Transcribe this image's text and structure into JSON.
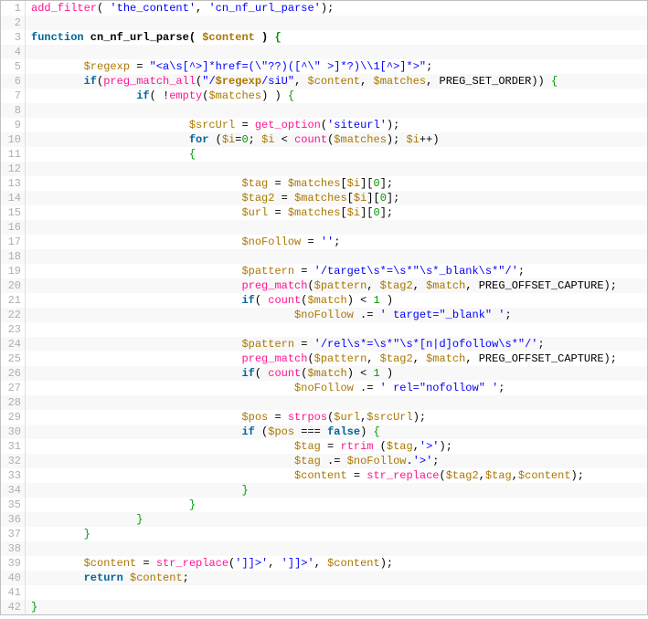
{
  "lines": [
    {
      "n": 1,
      "segs": [
        {
          "t": "add_filter",
          "c": "fn"
        },
        {
          "t": "( ",
          "c": ""
        },
        {
          "t": "'the_content'",
          "c": "str"
        },
        {
          "t": ", ",
          "c": ""
        },
        {
          "t": "'cn_nf_url_parse'",
          "c": "str"
        },
        {
          "t": ");",
          "c": ""
        }
      ]
    },
    {
      "n": 2,
      "segs": []
    },
    {
      "n": 3,
      "segs": [
        {
          "t": "function",
          "c": "kw bold"
        },
        {
          "t": " cn_nf_url_parse( ",
          "c": "bold"
        },
        {
          "t": "$content",
          "c": "var bold"
        },
        {
          "t": " ) ",
          "c": "bold"
        },
        {
          "t": "{",
          "c": "brace bold"
        }
      ]
    },
    {
      "n": 4,
      "segs": []
    },
    {
      "n": 5,
      "segs": [
        {
          "t": "        ",
          "c": ""
        },
        {
          "t": "$regexp",
          "c": "var"
        },
        {
          "t": " = ",
          "c": ""
        },
        {
          "t": "\"<a\\s[^>]*href=(\\\"??)([^\\\" >]*?)\\\\1[^>]*>\"",
          "c": "str"
        },
        {
          "t": ";",
          "c": ""
        }
      ]
    },
    {
      "n": 6,
      "segs": [
        {
          "t": "        ",
          "c": ""
        },
        {
          "t": "if",
          "c": "kw"
        },
        {
          "t": "(",
          "c": ""
        },
        {
          "t": "preg_match_all",
          "c": "fn"
        },
        {
          "t": "(",
          "c": ""
        },
        {
          "t": "\"/",
          "c": "str"
        },
        {
          "t": "$regexp",
          "c": "var bold"
        },
        {
          "t": "/siU\"",
          "c": "str"
        },
        {
          "t": ", ",
          "c": ""
        },
        {
          "t": "$content",
          "c": "var"
        },
        {
          "t": ", ",
          "c": ""
        },
        {
          "t": "$matches",
          "c": "var"
        },
        {
          "t": ", PREG_SET_ORDER)) ",
          "c": ""
        },
        {
          "t": "{",
          "c": "brace"
        }
      ]
    },
    {
      "n": 7,
      "segs": [
        {
          "t": "                ",
          "c": ""
        },
        {
          "t": "if",
          "c": "kw"
        },
        {
          "t": "( !",
          "c": ""
        },
        {
          "t": "empty",
          "c": "fn"
        },
        {
          "t": "(",
          "c": ""
        },
        {
          "t": "$matches",
          "c": "var"
        },
        {
          "t": ") ) ",
          "c": ""
        },
        {
          "t": "{",
          "c": "brace"
        }
      ]
    },
    {
      "n": 8,
      "segs": []
    },
    {
      "n": 9,
      "segs": [
        {
          "t": "                        ",
          "c": ""
        },
        {
          "t": "$srcUrl",
          "c": "var"
        },
        {
          "t": " = ",
          "c": ""
        },
        {
          "t": "get_option",
          "c": "fn"
        },
        {
          "t": "(",
          "c": ""
        },
        {
          "t": "'siteurl'",
          "c": "str"
        },
        {
          "t": ");",
          "c": ""
        }
      ]
    },
    {
      "n": 10,
      "segs": [
        {
          "t": "                        ",
          "c": ""
        },
        {
          "t": "for",
          "c": "kw"
        },
        {
          "t": " (",
          "c": ""
        },
        {
          "t": "$i",
          "c": "var"
        },
        {
          "t": "=",
          "c": ""
        },
        {
          "t": "0",
          "c": "num"
        },
        {
          "t": "; ",
          "c": ""
        },
        {
          "t": "$i",
          "c": "var"
        },
        {
          "t": " < ",
          "c": ""
        },
        {
          "t": "count",
          "c": "fn"
        },
        {
          "t": "(",
          "c": ""
        },
        {
          "t": "$matches",
          "c": "var"
        },
        {
          "t": "); ",
          "c": ""
        },
        {
          "t": "$i",
          "c": "var"
        },
        {
          "t": "++)",
          "c": ""
        }
      ]
    },
    {
      "n": 11,
      "segs": [
        {
          "t": "                        ",
          "c": ""
        },
        {
          "t": "{",
          "c": "brace"
        }
      ]
    },
    {
      "n": 12,
      "segs": []
    },
    {
      "n": 13,
      "segs": [
        {
          "t": "                                ",
          "c": ""
        },
        {
          "t": "$tag",
          "c": "var"
        },
        {
          "t": " = ",
          "c": ""
        },
        {
          "t": "$matches",
          "c": "var"
        },
        {
          "t": "[",
          "c": ""
        },
        {
          "t": "$i",
          "c": "var"
        },
        {
          "t": "][",
          "c": ""
        },
        {
          "t": "0",
          "c": "num"
        },
        {
          "t": "];",
          "c": ""
        }
      ]
    },
    {
      "n": 14,
      "segs": [
        {
          "t": "                                ",
          "c": ""
        },
        {
          "t": "$tag2",
          "c": "var"
        },
        {
          "t": " = ",
          "c": ""
        },
        {
          "t": "$matches",
          "c": "var"
        },
        {
          "t": "[",
          "c": ""
        },
        {
          "t": "$i",
          "c": "var"
        },
        {
          "t": "][",
          "c": ""
        },
        {
          "t": "0",
          "c": "num"
        },
        {
          "t": "];",
          "c": ""
        }
      ]
    },
    {
      "n": 15,
      "segs": [
        {
          "t": "                                ",
          "c": ""
        },
        {
          "t": "$url",
          "c": "var"
        },
        {
          "t": " = ",
          "c": ""
        },
        {
          "t": "$matches",
          "c": "var"
        },
        {
          "t": "[",
          "c": ""
        },
        {
          "t": "$i",
          "c": "var"
        },
        {
          "t": "][",
          "c": ""
        },
        {
          "t": "0",
          "c": "num"
        },
        {
          "t": "];",
          "c": ""
        }
      ]
    },
    {
      "n": 16,
      "segs": []
    },
    {
      "n": 17,
      "segs": [
        {
          "t": "                                ",
          "c": ""
        },
        {
          "t": "$noFollow",
          "c": "var"
        },
        {
          "t": " = ",
          "c": ""
        },
        {
          "t": "''",
          "c": "str"
        },
        {
          "t": ";",
          "c": ""
        }
      ]
    },
    {
      "n": 18,
      "segs": []
    },
    {
      "n": 19,
      "segs": [
        {
          "t": "                                ",
          "c": ""
        },
        {
          "t": "$pattern",
          "c": "var"
        },
        {
          "t": " = ",
          "c": ""
        },
        {
          "t": "'/target\\s*=\\s*\"\\s*_blank\\s*\"/'",
          "c": "str"
        },
        {
          "t": ";",
          "c": ""
        }
      ]
    },
    {
      "n": 20,
      "segs": [
        {
          "t": "                                ",
          "c": ""
        },
        {
          "t": "preg_match",
          "c": "fn"
        },
        {
          "t": "(",
          "c": ""
        },
        {
          "t": "$pattern",
          "c": "var"
        },
        {
          "t": ", ",
          "c": ""
        },
        {
          "t": "$tag2",
          "c": "var"
        },
        {
          "t": ", ",
          "c": ""
        },
        {
          "t": "$match",
          "c": "var"
        },
        {
          "t": ", PREG_OFFSET_CAPTURE);",
          "c": ""
        }
      ]
    },
    {
      "n": 21,
      "segs": [
        {
          "t": "                                ",
          "c": ""
        },
        {
          "t": "if",
          "c": "kw"
        },
        {
          "t": "( ",
          "c": ""
        },
        {
          "t": "count",
          "c": "fn"
        },
        {
          "t": "(",
          "c": ""
        },
        {
          "t": "$match",
          "c": "var"
        },
        {
          "t": ") < ",
          "c": ""
        },
        {
          "t": "1",
          "c": "num"
        },
        {
          "t": " )",
          "c": ""
        }
      ]
    },
    {
      "n": 22,
      "segs": [
        {
          "t": "                                        ",
          "c": ""
        },
        {
          "t": "$noFollow",
          "c": "var"
        },
        {
          "t": " .= ",
          "c": ""
        },
        {
          "t": "' target=\"_blank\" '",
          "c": "str"
        },
        {
          "t": ";",
          "c": ""
        }
      ]
    },
    {
      "n": 23,
      "segs": []
    },
    {
      "n": 24,
      "segs": [
        {
          "t": "                                ",
          "c": ""
        },
        {
          "t": "$pattern",
          "c": "var"
        },
        {
          "t": " = ",
          "c": ""
        },
        {
          "t": "'/rel\\s*=\\s*\"\\s*[n|d]ofollow\\s*\"/'",
          "c": "str"
        },
        {
          "t": ";",
          "c": ""
        }
      ]
    },
    {
      "n": 25,
      "segs": [
        {
          "t": "                                ",
          "c": ""
        },
        {
          "t": "preg_match",
          "c": "fn"
        },
        {
          "t": "(",
          "c": ""
        },
        {
          "t": "$pattern",
          "c": "var"
        },
        {
          "t": ", ",
          "c": ""
        },
        {
          "t": "$tag2",
          "c": "var"
        },
        {
          "t": ", ",
          "c": ""
        },
        {
          "t": "$match",
          "c": "var"
        },
        {
          "t": ", PREG_OFFSET_CAPTURE);",
          "c": ""
        }
      ]
    },
    {
      "n": 26,
      "segs": [
        {
          "t": "                                ",
          "c": ""
        },
        {
          "t": "if",
          "c": "kw"
        },
        {
          "t": "( ",
          "c": ""
        },
        {
          "t": "count",
          "c": "fn"
        },
        {
          "t": "(",
          "c": ""
        },
        {
          "t": "$match",
          "c": "var"
        },
        {
          "t": ") < ",
          "c": ""
        },
        {
          "t": "1",
          "c": "num"
        },
        {
          "t": " )",
          "c": ""
        }
      ]
    },
    {
      "n": 27,
      "segs": [
        {
          "t": "                                        ",
          "c": ""
        },
        {
          "t": "$noFollow",
          "c": "var"
        },
        {
          "t": " .= ",
          "c": ""
        },
        {
          "t": "' rel=\"nofollow\" '",
          "c": "str"
        },
        {
          "t": ";",
          "c": ""
        }
      ]
    },
    {
      "n": 28,
      "segs": []
    },
    {
      "n": 29,
      "segs": [
        {
          "t": "                                ",
          "c": ""
        },
        {
          "t": "$pos",
          "c": "var"
        },
        {
          "t": " = ",
          "c": ""
        },
        {
          "t": "strpos",
          "c": "fn"
        },
        {
          "t": "(",
          "c": ""
        },
        {
          "t": "$url",
          "c": "var"
        },
        {
          "t": ",",
          "c": ""
        },
        {
          "t": "$srcUrl",
          "c": "var"
        },
        {
          "t": ");",
          "c": ""
        }
      ]
    },
    {
      "n": 30,
      "segs": [
        {
          "t": "                                ",
          "c": ""
        },
        {
          "t": "if",
          "c": "kw"
        },
        {
          "t": " (",
          "c": ""
        },
        {
          "t": "$pos",
          "c": "var"
        },
        {
          "t": " === ",
          "c": ""
        },
        {
          "t": "false",
          "c": "kw"
        },
        {
          "t": ") ",
          "c": ""
        },
        {
          "t": "{",
          "c": "brace"
        }
      ]
    },
    {
      "n": 31,
      "segs": [
        {
          "t": "                                        ",
          "c": ""
        },
        {
          "t": "$tag",
          "c": "var"
        },
        {
          "t": " = ",
          "c": ""
        },
        {
          "t": "rtrim",
          "c": "fn"
        },
        {
          "t": " (",
          "c": ""
        },
        {
          "t": "$tag",
          "c": "var"
        },
        {
          "t": ",",
          "c": ""
        },
        {
          "t": "'>'",
          "c": "str"
        },
        {
          "t": ");",
          "c": ""
        }
      ]
    },
    {
      "n": 32,
      "segs": [
        {
          "t": "                                        ",
          "c": ""
        },
        {
          "t": "$tag",
          "c": "var"
        },
        {
          "t": " .= ",
          "c": ""
        },
        {
          "t": "$noFollow",
          "c": "var"
        },
        {
          "t": ".",
          "c": ""
        },
        {
          "t": "'>'",
          "c": "str"
        },
        {
          "t": ";",
          "c": ""
        }
      ]
    },
    {
      "n": 33,
      "segs": [
        {
          "t": "                                        ",
          "c": ""
        },
        {
          "t": "$content",
          "c": "var"
        },
        {
          "t": " = ",
          "c": ""
        },
        {
          "t": "str_replace",
          "c": "fn"
        },
        {
          "t": "(",
          "c": ""
        },
        {
          "t": "$tag2",
          "c": "var"
        },
        {
          "t": ",",
          "c": ""
        },
        {
          "t": "$tag",
          "c": "var"
        },
        {
          "t": ",",
          "c": ""
        },
        {
          "t": "$content",
          "c": "var"
        },
        {
          "t": ");",
          "c": ""
        }
      ]
    },
    {
      "n": 34,
      "segs": [
        {
          "t": "                                ",
          "c": ""
        },
        {
          "t": "}",
          "c": "brace"
        }
      ]
    },
    {
      "n": 35,
      "segs": [
        {
          "t": "                        ",
          "c": ""
        },
        {
          "t": "}",
          "c": "brace"
        }
      ]
    },
    {
      "n": 36,
      "segs": [
        {
          "t": "                ",
          "c": ""
        },
        {
          "t": "}",
          "c": "brace"
        }
      ]
    },
    {
      "n": 37,
      "segs": [
        {
          "t": "        ",
          "c": ""
        },
        {
          "t": "}",
          "c": "brace"
        }
      ]
    },
    {
      "n": 38,
      "segs": []
    },
    {
      "n": 39,
      "segs": [
        {
          "t": "        ",
          "c": ""
        },
        {
          "t": "$content",
          "c": "var"
        },
        {
          "t": " = ",
          "c": ""
        },
        {
          "t": "str_replace",
          "c": "fn"
        },
        {
          "t": "(",
          "c": ""
        },
        {
          "t": "']]>'",
          "c": "str"
        },
        {
          "t": ", ",
          "c": ""
        },
        {
          "t": "']]>'",
          "c": "str"
        },
        {
          "t": ", ",
          "c": ""
        },
        {
          "t": "$content",
          "c": "var"
        },
        {
          "t": ");",
          "c": ""
        }
      ]
    },
    {
      "n": 40,
      "segs": [
        {
          "t": "        ",
          "c": ""
        },
        {
          "t": "return",
          "c": "kw"
        },
        {
          "t": " ",
          "c": ""
        },
        {
          "t": "$content",
          "c": "var"
        },
        {
          "t": ";",
          "c": ""
        }
      ]
    },
    {
      "n": 41,
      "segs": []
    },
    {
      "n": 42,
      "segs": [
        {
          "t": "}",
          "c": "brace"
        }
      ]
    }
  ]
}
